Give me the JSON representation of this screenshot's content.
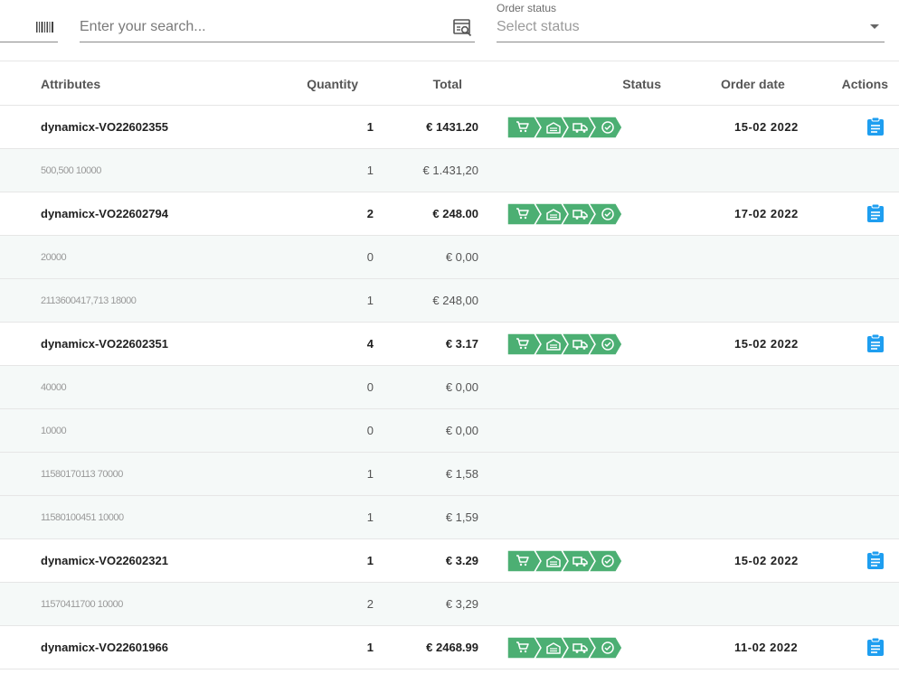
{
  "filters": {
    "barcode_icon": "barcode-icon",
    "search_placeholder": "Enter your search...",
    "search_icon": "search-document-icon",
    "status_label": "Order status",
    "status_placeholder": "Select status"
  },
  "colors": {
    "status_green": "#4caf73",
    "action_blue": "#1e9ef0"
  },
  "table": {
    "headers": {
      "attributes": "Attributes",
      "quantity": "Quantity",
      "total": "Total",
      "status": "Status",
      "order_date": "Order date",
      "actions": "Actions"
    },
    "status_steps": [
      "cart-icon",
      "warehouse-icon",
      "truck-icon",
      "check-circle-icon"
    ],
    "rows": [
      {
        "type": "main",
        "attr": "dynamicx-VO22602355",
        "qty": "1",
        "total": "€ 1431.20",
        "date": "15-02 2022"
      },
      {
        "type": "sub",
        "attr": "500,500 10000",
        "qty": "1",
        "total": "€ 1.431,20"
      },
      {
        "type": "main",
        "attr": "dynamicx-VO22602794",
        "qty": "2",
        "total": "€ 248.00",
        "date": "17-02 2022"
      },
      {
        "type": "sub",
        "attr": "20000",
        "qty": "0",
        "total": "€ 0,00"
      },
      {
        "type": "sub",
        "attr": "2113600417,713 18000",
        "qty": "1",
        "total": "€ 248,00"
      },
      {
        "type": "main",
        "attr": "dynamicx-VO22602351",
        "qty": "4",
        "total": "€ 3.17",
        "date": "15-02 2022"
      },
      {
        "type": "sub",
        "attr": "40000",
        "qty": "0",
        "total": "€ 0,00"
      },
      {
        "type": "sub",
        "attr": "10000",
        "qty": "0",
        "total": "€ 0,00"
      },
      {
        "type": "sub",
        "attr": "11580170113 70000",
        "qty": "1",
        "total": "€ 1,58"
      },
      {
        "type": "sub",
        "attr": "11580100451 10000",
        "qty": "1",
        "total": "€ 1,59"
      },
      {
        "type": "main",
        "attr": "dynamicx-VO22602321",
        "qty": "1",
        "total": "€ 3.29",
        "date": "15-02 2022"
      },
      {
        "type": "sub",
        "attr": "11570411700 10000",
        "qty": "2",
        "total": "€ 3,29"
      },
      {
        "type": "main",
        "attr": "dynamicx-VO22601966",
        "qty": "1",
        "total": "€ 2468.99",
        "date": "11-02 2022"
      }
    ]
  }
}
